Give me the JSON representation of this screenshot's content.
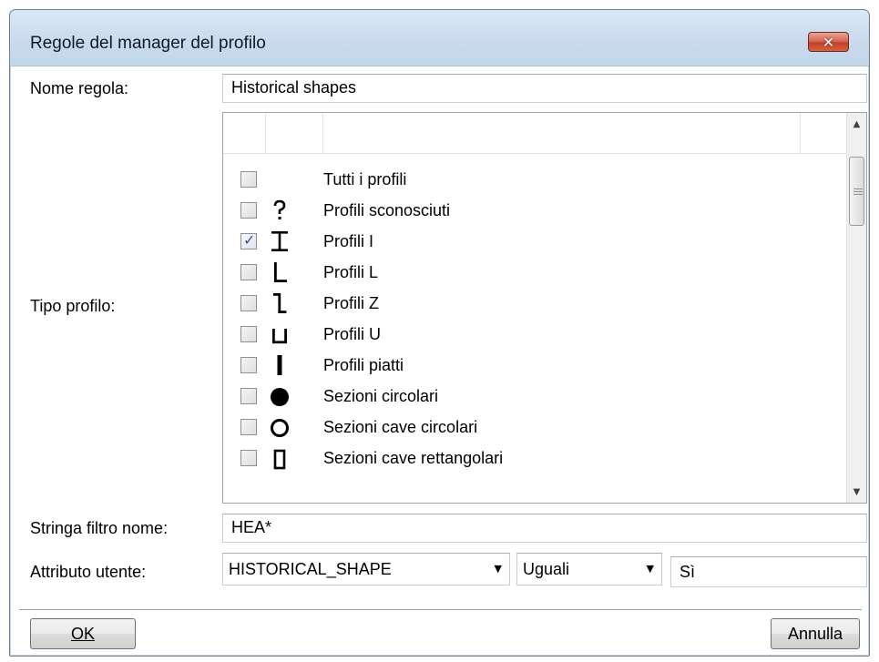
{
  "window": {
    "title": "Regole del manager del profilo",
    "close_symbol": "✕"
  },
  "rule_name": {
    "label": "Nome regola:",
    "value": "Historical shapes"
  },
  "profile_type": {
    "label": "Tipo profilo:",
    "items": [
      {
        "label": "Tutti i profili",
        "checked": false,
        "icon": "none"
      },
      {
        "label": "Profili sconosciuti",
        "checked": false,
        "icon": "question-mark-icon"
      },
      {
        "label": "Profili I",
        "checked": true,
        "icon": "i-profile-icon"
      },
      {
        "label": "Profili L",
        "checked": false,
        "icon": "l-profile-icon"
      },
      {
        "label": "Profili Z",
        "checked": false,
        "icon": "z-profile-icon"
      },
      {
        "label": "Profili U",
        "checked": false,
        "icon": "u-profile-icon"
      },
      {
        "label": "Profili piatti",
        "checked": false,
        "icon": "flat-profile-icon"
      },
      {
        "label": "Sezioni circolari",
        "checked": false,
        "icon": "circular-section-icon"
      },
      {
        "label": "Sezioni cave circolari",
        "checked": false,
        "icon": "hollow-circular-section-icon"
      },
      {
        "label": "Sezioni cave rettangolari",
        "checked": false,
        "icon": "hollow-rectangular-section-icon"
      }
    ],
    "check_mark": "✓"
  },
  "name_filter": {
    "label": "Stringa filtro nome:",
    "value": "HEA*"
  },
  "user_attribute": {
    "label": "Attributo utente:",
    "attribute": "HISTORICAL_SHAPE",
    "operator": "Uguali",
    "value": "Sì"
  },
  "buttons": {
    "ok": "OK",
    "cancel": "Annulla"
  }
}
